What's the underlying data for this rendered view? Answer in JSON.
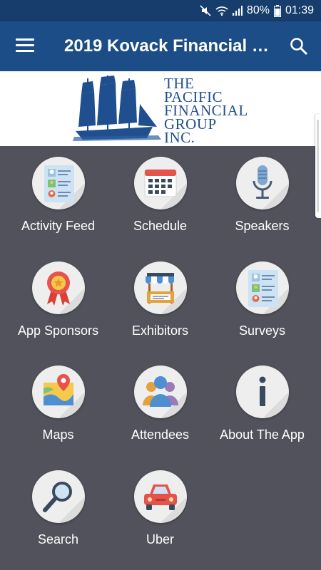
{
  "status_bar": {
    "battery": "80%",
    "time": "01:39"
  },
  "app_bar": {
    "title": "2019 Kovack Financial C..."
  },
  "banner": {
    "logo_lines": [
      "THE",
      "PACIFIC",
      "FINANCIAL",
      "GROUP",
      "INC."
    ]
  },
  "menu": {
    "items": [
      {
        "label": "Activity Feed",
        "icon": "activity-feed-icon"
      },
      {
        "label": "Schedule",
        "icon": "calendar-icon"
      },
      {
        "label": "Speakers",
        "icon": "microphone-icon"
      },
      {
        "label": "App Sponsors",
        "icon": "ribbon-badge-icon"
      },
      {
        "label": "Exhibitors",
        "icon": "booth-icon"
      },
      {
        "label": "Surveys",
        "icon": "survey-icon"
      },
      {
        "label": "Maps",
        "icon": "map-pin-icon"
      },
      {
        "label": "Attendees",
        "icon": "people-icon"
      },
      {
        "label": "About The App",
        "icon": "info-icon"
      },
      {
        "label": "Search",
        "icon": "magnifier-icon"
      },
      {
        "label": "Uber",
        "icon": "car-icon"
      }
    ]
  }
}
